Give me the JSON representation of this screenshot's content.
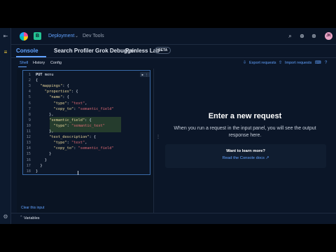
{
  "header": {
    "space_letter": "B",
    "breadcrumb_deployment": "Deployment",
    "breadcrumb_chevron": "⌄",
    "breadcrumb_devtools": "Dev Tools",
    "avatar_initials": "JK"
  },
  "tabs": [
    {
      "label": "Console",
      "active": true
    },
    {
      "label": "Search Profiler"
    },
    {
      "label": "Grok Debugger"
    },
    {
      "label": "Painless Lab"
    }
  ],
  "beta_badge": "BETA",
  "subnav": {
    "shell": "Shell",
    "history": "History",
    "config": "Config",
    "export": "Export requests",
    "import": "Import requests"
  },
  "editor": {
    "run_label": "▶ ⋮",
    "lines": [
      {
        "n": "1",
        "text": "PUT menu"
      },
      {
        "n": "2",
        "text": "{"
      },
      {
        "n": "3",
        "text": "  \"mappings\": {"
      },
      {
        "n": "4",
        "text": "    \"properties\": {"
      },
      {
        "n": "5",
        "text": "      \"name\": {"
      },
      {
        "n": "6",
        "text": "        \"type\": \"text\","
      },
      {
        "n": "7",
        "text": "        \"copy_to\": \"semantic_field\""
      },
      {
        "n": "8",
        "text": "      },"
      },
      {
        "n": "9",
        "text": "      \"semantic_field\": {"
      },
      {
        "n": "10",
        "text": "        \"type\": \"semantic_text\""
      },
      {
        "n": "11",
        "text": "      },"
      },
      {
        "n": "12",
        "text": "      \"text_description\": {"
      },
      {
        "n": "13",
        "text": "        \"type\": \"text\","
      },
      {
        "n": "14",
        "text": "        \"copy_to\": \"semantic_field\""
      },
      {
        "n": "15",
        "text": "      }"
      },
      {
        "n": "16",
        "text": "    }"
      },
      {
        "n": "17",
        "text": "  }"
      },
      {
        "n": "18",
        "text": "}"
      }
    ]
  },
  "clear_input": "Clear this input",
  "output": {
    "title": "Enter a new request",
    "text": "When you run a request in the input panel, you will see the output response here.",
    "learn_title": "Want to learn more?",
    "learn_link": "Read the Console docs ↗"
  },
  "bottom": {
    "variables": "Variables",
    "chevron": "⌃"
  },
  "colors": {
    "background": "#0b1628",
    "accent": "#61a2ff",
    "highlight": "#3b5b32"
  }
}
